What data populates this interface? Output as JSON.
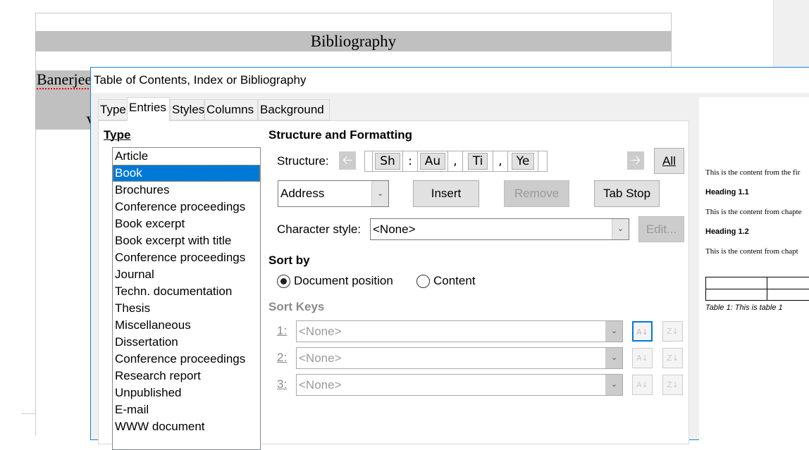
{
  "document": {
    "heading": "Bibliography",
    "entry_fragment": "Banerjee",
    "entry_second_line": "V"
  },
  "dialog": {
    "title": "Table of Contents, Index or Bibliography",
    "tabs": [
      {
        "label": "Type",
        "active": false
      },
      {
        "label": "Entries",
        "active": true
      },
      {
        "label": "Styles",
        "active": false
      },
      {
        "label": "Columns",
        "active": false
      },
      {
        "label": "Background",
        "active": false
      }
    ],
    "type_section": {
      "heading": "Type",
      "items": [
        "Article",
        "Book",
        "Brochures",
        "Conference proceedings",
        "Book excerpt",
        "Book excerpt with title",
        "Conference proceedings",
        "Journal",
        "Techn. documentation",
        "Thesis",
        "Miscellaneous",
        "Dissertation",
        "Conference proceedings",
        "Research report",
        "Unpublished",
        "E-mail",
        "WWW document"
      ],
      "selected": "Book"
    },
    "structure": {
      "heading": "Structure and Formatting",
      "label": "Structure:",
      "tokens": [
        {
          "type": "text",
          "value": ""
        },
        {
          "type": "field",
          "value": "Sh"
        },
        {
          "type": "text",
          "value": ":"
        },
        {
          "type": "field",
          "value": "Au"
        },
        {
          "type": "text",
          "value": ","
        },
        {
          "type": "field",
          "value": "Ti"
        },
        {
          "type": "text",
          "value": ","
        },
        {
          "type": "field",
          "value": "Ye"
        },
        {
          "type": "text",
          "value": ""
        }
      ],
      "all_button": "All",
      "field_select": "Address",
      "insert_button": "Insert",
      "remove_button": "Remove",
      "tab_stop_button": "Tab Stop",
      "char_style_label": "Character style:",
      "char_style_value": "<None>",
      "edit_button": "Edit..."
    },
    "sort_by": {
      "heading": "Sort by",
      "options": [
        {
          "label": "Document position",
          "selected": true
        },
        {
          "label": "Content",
          "selected": false
        }
      ]
    },
    "sort_keys": {
      "heading": "Sort Keys",
      "keys": [
        {
          "label": "1:",
          "value": "<None>"
        },
        {
          "label": "2:",
          "value": "<None>"
        },
        {
          "label": "3:",
          "value": "<None>"
        }
      ]
    },
    "preview": {
      "line1": "This is the content from the fir",
      "heading1": "Heading 1.1",
      "line2": "This is the content from chapte",
      "heading2": "Heading 1.2",
      "line3": "This is the content from chapt",
      "caption": "Table 1: This is table 1"
    }
  },
  "colors": {
    "accent": "#0078d7",
    "dialog_border": "#1883d7",
    "field_band": "#c0c0c0"
  }
}
